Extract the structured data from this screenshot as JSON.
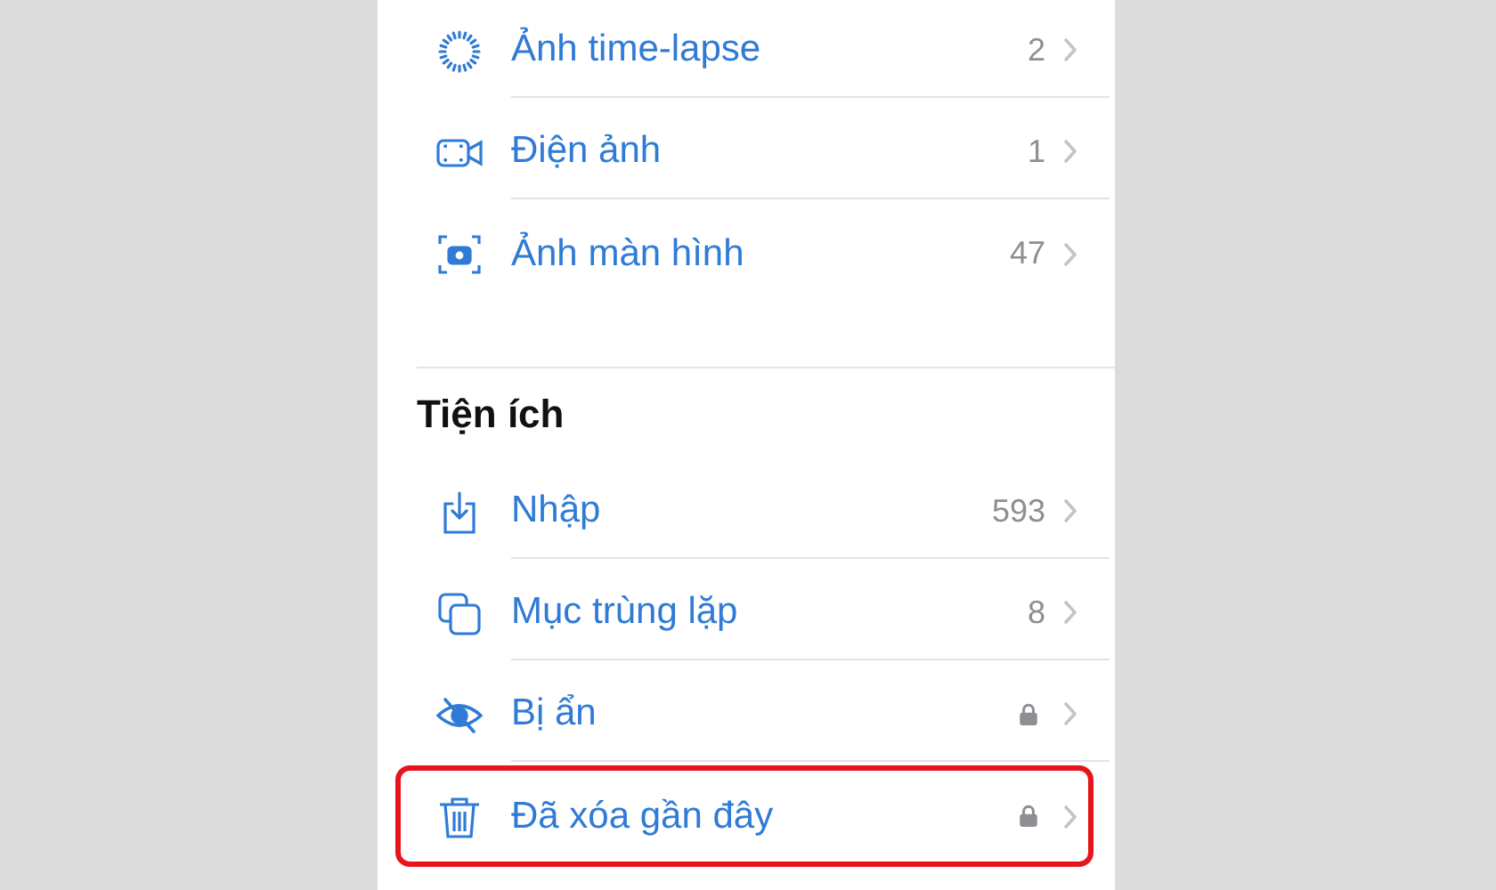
{
  "sections": [
    {
      "items": [
        {
          "kind": "timelapse",
          "label": "Ảnh time-lapse",
          "count": "2"
        },
        {
          "kind": "cinematic",
          "label": "Điện ảnh",
          "count": "1"
        },
        {
          "kind": "screenshot",
          "label": "Ảnh màn hình",
          "count": "47"
        }
      ]
    },
    {
      "title": "Tiện ích",
      "items": [
        {
          "kind": "import",
          "label": "Nhập",
          "count": "593"
        },
        {
          "kind": "duplicates",
          "label": "Mục trùng lặp",
          "count": "8"
        },
        {
          "kind": "hidden",
          "label": "Bị ẩn",
          "locked": true
        },
        {
          "kind": "trash",
          "label": "Đã xóa gần đây",
          "locked": true,
          "highlighted": true
        }
      ]
    }
  ]
}
